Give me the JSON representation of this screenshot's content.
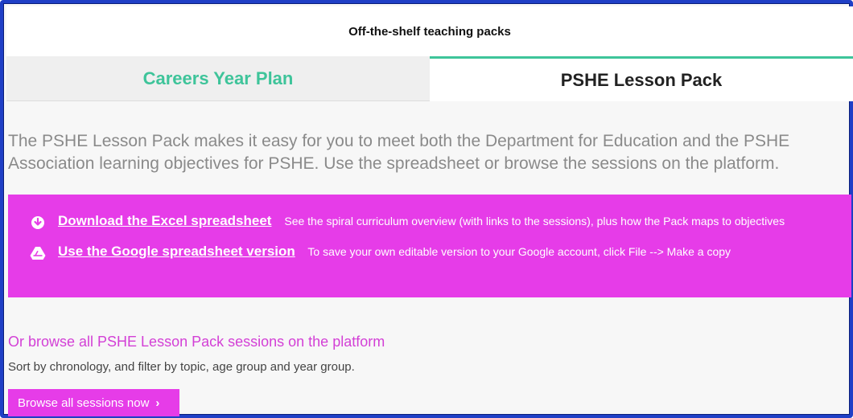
{
  "header": {
    "title": "Off-the-shelf teaching packs"
  },
  "tabs": [
    {
      "label": "Careers Year Plan",
      "active": false
    },
    {
      "label": "PSHE Lesson Pack",
      "active": true
    }
  ],
  "intro": {
    "text": "The PSHE Lesson Pack makes it easy for you to meet both the Department for Education and the PSHE Association learning objectives for PSHE. Use the spreadsheet or browse the sessions on the platform."
  },
  "resources": [
    {
      "icon": "download-icon",
      "link": "Download the Excel spreadsheet",
      "description": "See the spiral curriculum overview (with links to the sessions), plus how the Pack maps to objectives"
    },
    {
      "icon": "google-drive-icon",
      "link": "Use the Google spreadsheet version",
      "description": "To save your own editable version to your Google account, click File --> Make a copy"
    }
  ],
  "browse": {
    "heading": "Or browse all PSHE Lesson Pack sessions on the platform",
    "subtitle": "Sort by chronology, and filter by topic, age group and year group.",
    "button_label": "Browse all sessions now",
    "button_icon": "chevron-right-icon"
  },
  "colors": {
    "accent_green": "#3ec49a",
    "accent_magenta": "#e63ce8",
    "border_blue": "#1f3fc6"
  }
}
